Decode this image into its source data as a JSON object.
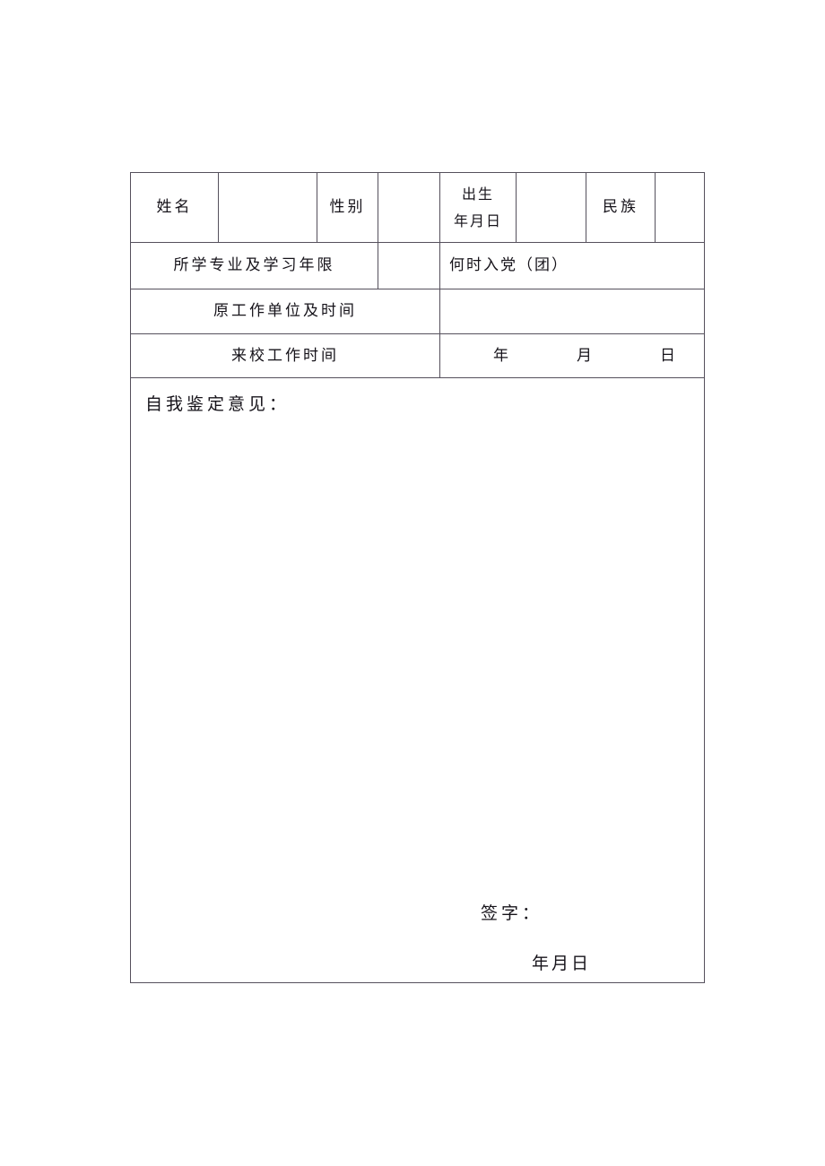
{
  "document": {
    "type": "form",
    "language": "zh-CN",
    "memo_title": "自我鉴定意见：",
    "signature_label": "签字：",
    "signature_date": "年月日"
  },
  "table": {
    "rows": [
      {
        "name": "identity-row",
        "cells": [
          {
            "label": "姓名",
            "kind": "label"
          },
          {
            "label": "",
            "kind": "blank"
          },
          {
            "label": "性别",
            "kind": "label"
          },
          {
            "label": "",
            "kind": "blank"
          },
          {
            "label_line1": "出生",
            "label_line2": "年月日",
            "kind": "label-two-line"
          },
          {
            "label": "",
            "kind": "blank"
          },
          {
            "label": "民族",
            "kind": "label"
          },
          {
            "label": "",
            "kind": "blank"
          }
        ]
      },
      {
        "name": "major-party-row",
        "cells": [
          {
            "label": "所学专业及学习年限",
            "kind": "label"
          },
          {
            "label": "",
            "kind": "blank"
          },
          {
            "label": "何时入党（团）",
            "kind": "label-left"
          }
        ]
      },
      {
        "name": "previous-employer-row",
        "cells": [
          {
            "label": "原工作单位及时间",
            "kind": "label"
          },
          {
            "label": "",
            "kind": "blank"
          }
        ]
      },
      {
        "name": "start-date-row",
        "cells": [
          {
            "label": "来校工作时间",
            "kind": "label"
          },
          {
            "kind": "date-tokens",
            "tokens": [
              "年",
              "月",
              "日"
            ]
          }
        ]
      }
    ]
  }
}
